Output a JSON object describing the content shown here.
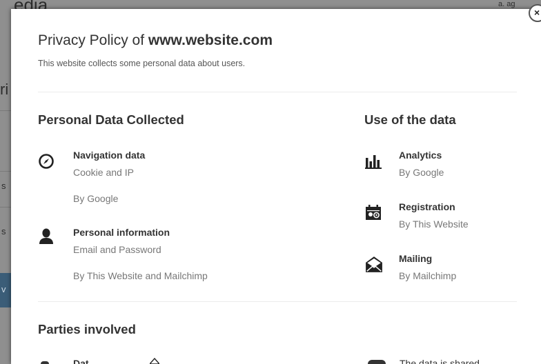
{
  "background": {
    "fragments": [
      "edia",
      "a.  ag",
      "ri",
      "s",
      "s",
      "v"
    ]
  },
  "modal": {
    "close_symbol": "×",
    "title_prefix": "Privacy Policy of",
    "title_site": "www.website.com",
    "subtitle": "This website collects some personal data about users.",
    "personal": {
      "heading": "Personal Data Collected",
      "items": [
        {
          "icon": "compass-icon",
          "name": "Navigation data",
          "desc": "Cookie and IP",
          "by": "By Google"
        },
        {
          "icon": "user-silhouette-icon",
          "name": "Personal information",
          "desc": "Email and Password",
          "by": "By This Website and Mailchimp"
        }
      ]
    },
    "use": {
      "heading": "Use of the data",
      "items": [
        {
          "icon": "bar-chart-icon",
          "name": "Analytics",
          "desc": "By Google"
        },
        {
          "icon": "registration-calendar-icon",
          "name": "Registration",
          "desc": "By This Website"
        },
        {
          "icon": "envelope-icon",
          "name": "Mailing",
          "desc": "By Mailchimp"
        }
      ]
    },
    "parties": {
      "heading": "Parties involved",
      "peek_left": "Dat",
      "peek_right": "The data is shared"
    }
  }
}
